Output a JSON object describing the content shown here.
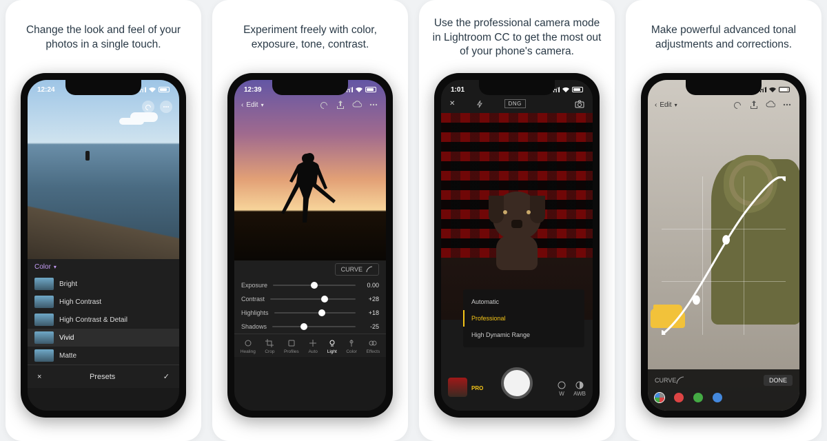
{
  "cards": [
    {
      "caption": "Change the look and feel of your photos in a single touch."
    },
    {
      "caption": "Experiment freely with color, exposure, tone, contrast."
    },
    {
      "caption": "Use the professional camera mode in Lightroom CC to get the most out of your phone's camera."
    },
    {
      "caption": "Make powerful advanced tonal adjustments and corrections."
    }
  ],
  "screen1": {
    "time": "12:24",
    "color_header": "Color",
    "presets": [
      "Bright",
      "High Contrast",
      "High Contrast & Detail",
      "Vivid",
      "Matte"
    ],
    "selected_preset": "Vivid",
    "bottom_title": "Presets",
    "close": "×",
    "confirm": "✓"
  },
  "screen2": {
    "time": "12:39",
    "back": "‹",
    "title": "Edit",
    "curve_btn": "CURVE",
    "sliders": [
      {
        "label": "Exposure",
        "value": "0.00",
        "pos": 50
      },
      {
        "label": "Contrast",
        "value": "+28",
        "pos": 64
      },
      {
        "label": "Highlights",
        "value": "+18",
        "pos": 59
      },
      {
        "label": "Shadows",
        "value": "-25",
        "pos": 38
      }
    ],
    "tools": [
      "Healing",
      "Crop",
      "Profiles",
      "Auto",
      "Light",
      "Color",
      "Effects"
    ],
    "selected_tool": "Light"
  },
  "screen3": {
    "time": "1:01",
    "format": "DNG",
    "modes": [
      "Automatic",
      "Professional",
      "High Dynamic Range"
    ],
    "selected_mode": "Professional",
    "pro_label": "PRO",
    "wb": "W",
    "awb": "AWB"
  },
  "screen4": {
    "back": "‹",
    "title": "Edit",
    "curve_label": "CURVE",
    "done": "DONE",
    "channels": [
      "rgb",
      "red",
      "green",
      "blue"
    ]
  }
}
